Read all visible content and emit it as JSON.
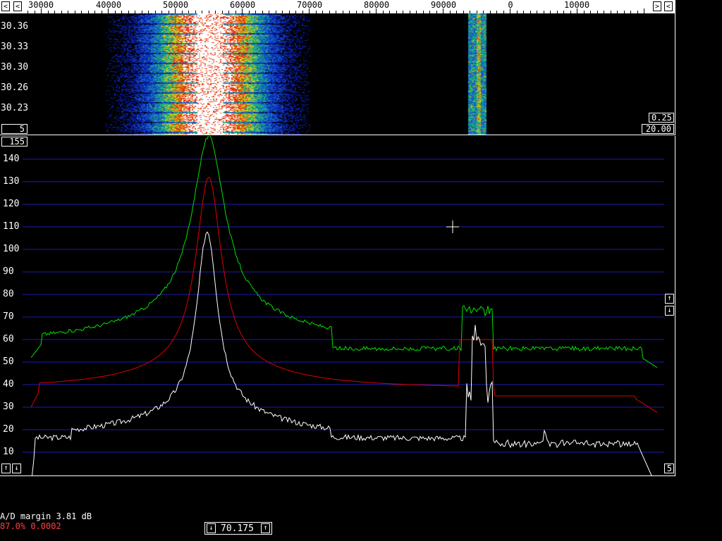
{
  "freq_scale": {
    "labels": [
      "30000",
      "40000",
      "50000",
      "60000",
      "70000",
      "80000",
      "90000",
      "0",
      "10000"
    ],
    "left_button": "<",
    "right_buttons": [
      ">",
      "<"
    ]
  },
  "waterfall": {
    "time_labels": [
      "30.36",
      "30.33",
      "30.30",
      "30.26",
      "30.23"
    ],
    "avg_box": "5",
    "gain_box": "0.25",
    "range_box": "20.00"
  },
  "spectrum": {
    "top_box": "155",
    "y_labels": [
      "140",
      "130",
      "120",
      "110",
      "100",
      "90",
      "80",
      "70",
      "60",
      "50",
      "40",
      "30",
      "20",
      "10"
    ],
    "bottom_right_box": "5",
    "bottom_left_buttons": [
      "↑",
      "↓"
    ],
    "right_buttons": [
      "↑",
      "↓"
    ]
  },
  "status": {
    "ad_margin": "A/D margin 3.81 dB",
    "load": "87.0% 0.0002"
  },
  "tuning": {
    "value": "70.175",
    "down_label": "↓",
    "up_label": "↑"
  },
  "colors": {
    "grid": "#1c1cb4",
    "green_trace": "#00e000",
    "red_trace": "#e00000",
    "white_trace": "#ffffff"
  }
}
